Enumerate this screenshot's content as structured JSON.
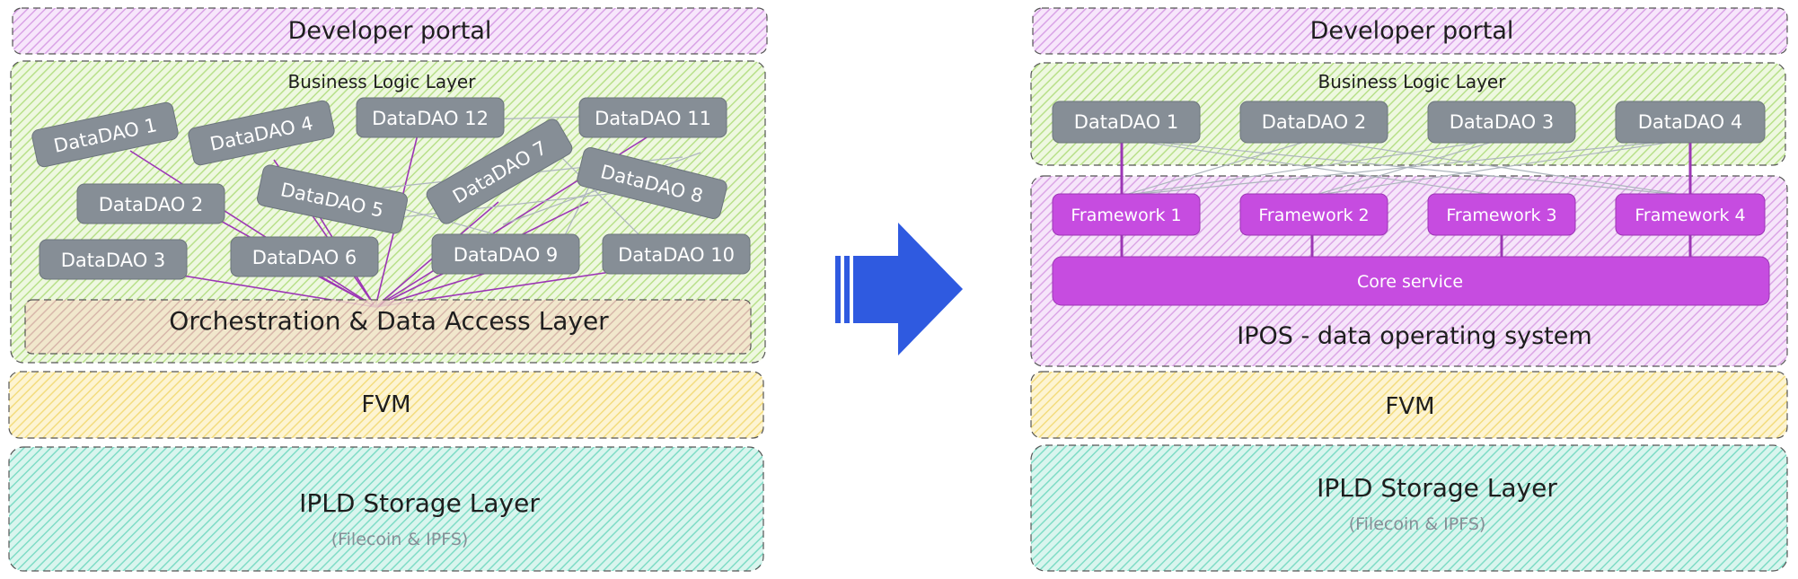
{
  "left": {
    "portal_label": "Developer portal",
    "business_label": "Business Logic Layer",
    "daos": [
      "DataDAO 1",
      "DataDAO 2",
      "DataDAO 3",
      "DataDAO 4",
      "DataDAO 5",
      "DataDAO 6",
      "DataDAO 7",
      "DataDAO 8",
      "DataDAO 9",
      "DataDAO 10",
      "DataDAO 11",
      "DataDAO 12"
    ],
    "orchestration_label": "Orchestration & Data Access Layer",
    "fvm_label": "FVM",
    "storage_label": "IPLD Storage Layer",
    "storage_sub": "(Filecoin & IPFS)"
  },
  "right": {
    "portal_label": "Developer portal",
    "business_label": "Business Logic Layer",
    "daos": [
      "DataDAO 1",
      "DataDAO 2",
      "DataDAO 3",
      "DataDAO 4"
    ],
    "frameworks": [
      "Framework 1",
      "Framework 2",
      "Framework 3",
      "Framework 4"
    ],
    "core_label": "Core service",
    "ipos_label": "IPOS - data operating system",
    "fvm_label": "FVM",
    "storage_label": "IPLD Storage Layer",
    "storage_sub": "(Filecoin & IPFS)"
  },
  "colors": {
    "portal": "#d9a3e6",
    "business": "#b8e08a",
    "orchestration": "#e0b0a8",
    "fvm": "#f3dc7e",
    "storage": "#7fdcc6",
    "ipos": "#dba6e6",
    "dao_box": "#868e96",
    "framework": "#c64ce0",
    "arrow": "#2f5ae0",
    "purple_line": "#9c36b5",
    "grey_line": "#adb5bd"
  }
}
